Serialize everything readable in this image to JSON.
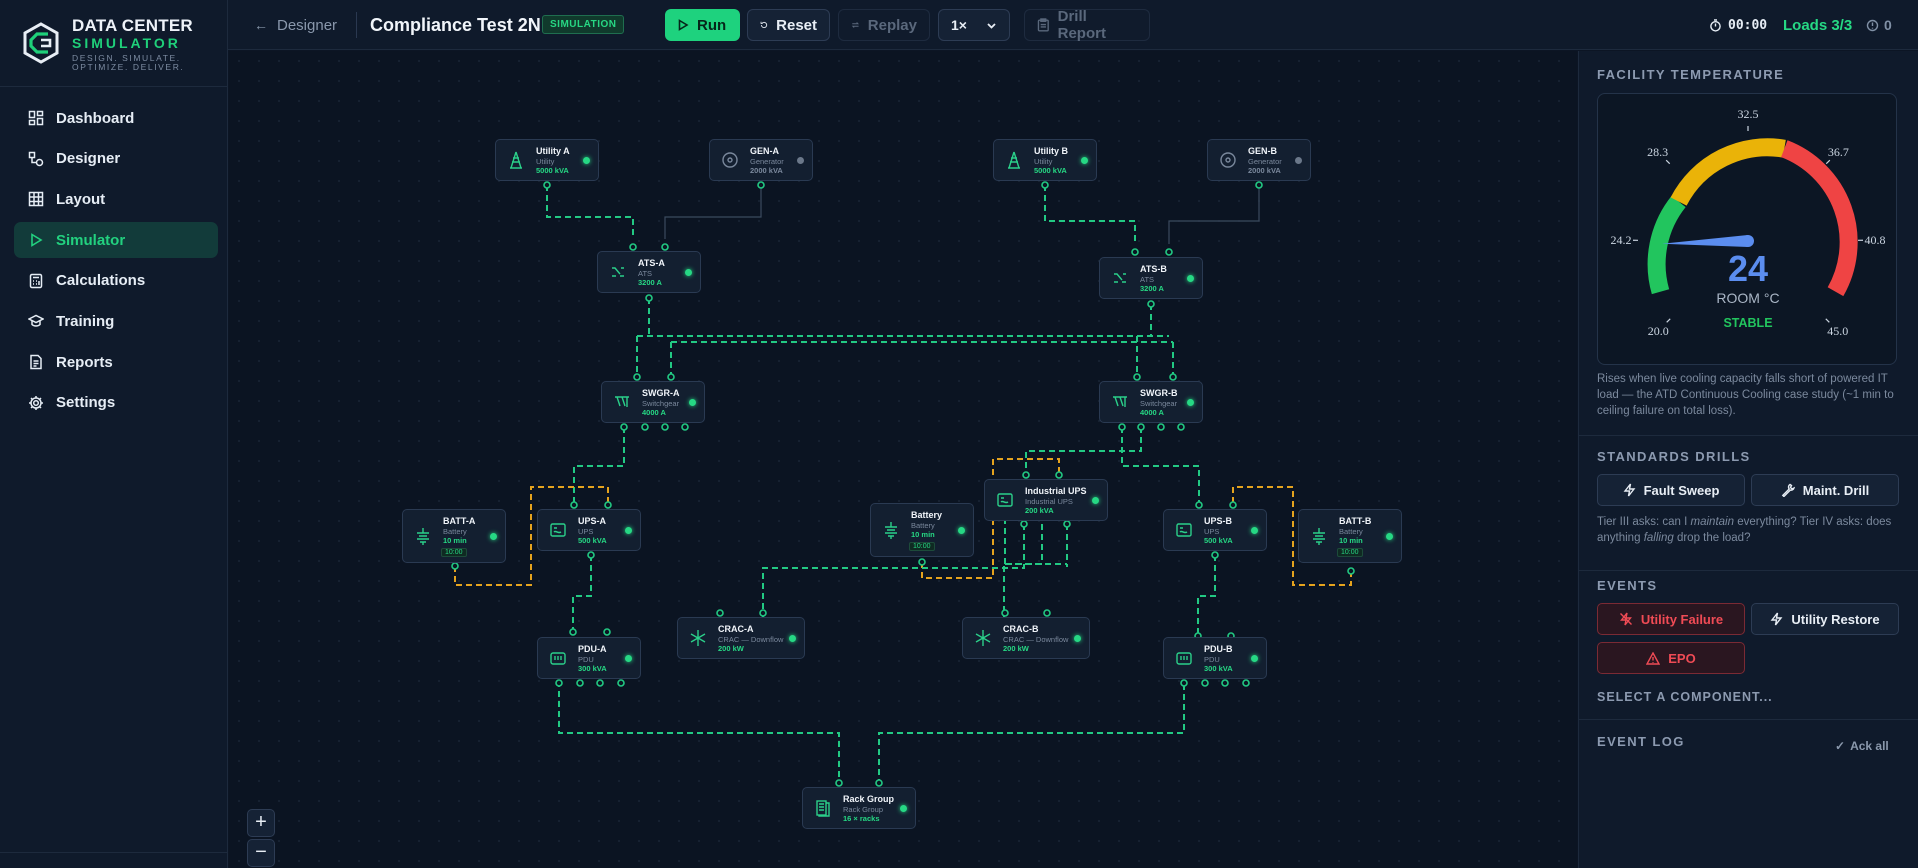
{
  "brand": {
    "line1": "DATA CENTER",
    "line2": "SIMULATOR",
    "tagline": "DESIGN. SIMULATE. OPTIMIZE. DELIVER."
  },
  "nav": [
    {
      "label": "Dashboard",
      "icon": "dashboard-icon"
    },
    {
      "label": "Designer",
      "icon": "designer-icon"
    },
    {
      "label": "Layout",
      "icon": "layout-grid-icon"
    },
    {
      "label": "Simulator",
      "icon": "play-icon",
      "active": true
    },
    {
      "label": "Calculations",
      "icon": "calculator-icon"
    },
    {
      "label": "Training",
      "icon": "graduation-cap-icon"
    },
    {
      "label": "Reports",
      "icon": "document-icon"
    },
    {
      "label": "Settings",
      "icon": "gear-icon"
    }
  ],
  "topbar": {
    "back_label": "Designer",
    "title": "Compliance Test 2N",
    "mode_badge": "SIMULATION",
    "run_label": "Run",
    "reset_label": "Reset",
    "replay_label": "Replay",
    "speed_value": "1×",
    "drill_report_label": "Drill Report",
    "timer": "00:00",
    "loads": "Loads 3/3",
    "alerts": "0"
  },
  "nodes": {
    "utility_a": {
      "name": "Utility A",
      "type": "Utility",
      "cap": "5000 kVA"
    },
    "gen_a": {
      "name": "GEN-A",
      "type": "Generator",
      "cap": "2000 kVA"
    },
    "utility_b": {
      "name": "Utility B",
      "type": "Utility",
      "cap": "5000 kVA"
    },
    "gen_b": {
      "name": "GEN-B",
      "type": "Generator",
      "cap": "2000 kVA"
    },
    "ats_a": {
      "name": "ATS-A",
      "type": "ATS",
      "cap": "3200 A"
    },
    "ats_b": {
      "name": "ATS-B",
      "type": "ATS",
      "cap": "3200 A"
    },
    "swgr_a": {
      "name": "SWGR-A",
      "type": "Switchgear",
      "cap": "4000 A"
    },
    "swgr_b": {
      "name": "SWGR-B",
      "type": "Switchgear",
      "cap": "4000 A"
    },
    "batt_a": {
      "name": "BATT-A",
      "type": "Battery",
      "cap": "10 min",
      "time": "10:00"
    },
    "ups_a": {
      "name": "UPS-A",
      "type": "UPS",
      "cap": "500 kVA"
    },
    "battery": {
      "name": "Battery",
      "type": "Battery",
      "cap": "10 min",
      "time": "10:00"
    },
    "industrial_ups": {
      "name": "Industrial UPS",
      "type": "Industrial UPS",
      "cap": "200 kVA"
    },
    "ups_b": {
      "name": "UPS-B",
      "type": "UPS",
      "cap": "500 kVA"
    },
    "batt_b": {
      "name": "BATT-B",
      "type": "Battery",
      "cap": "10 min",
      "time": "10:00"
    },
    "crac_a": {
      "name": "CRAC-A",
      "type": "CRAC — Downflow",
      "cap": "200 kW"
    },
    "crac_b": {
      "name": "CRAC-B",
      "type": "CRAC — Downflow",
      "cap": "200 kW"
    },
    "pdu_a": {
      "name": "PDU-A",
      "type": "PDU",
      "cap": "300 kVA"
    },
    "pdu_b": {
      "name": "PDU-B",
      "type": "PDU",
      "cap": "300 kVA"
    },
    "rack_group": {
      "name": "Rack Group",
      "type": "Rack Group",
      "cap": "16 × racks"
    }
  },
  "zoom": {
    "in": "+",
    "out": "−"
  },
  "panel": {
    "temp_title": "FACILITY TEMPERATURE",
    "gauge": {
      "value": "24",
      "unit_label": "ROOM °C",
      "status": "STABLE",
      "min": 20.0,
      "max": 45.0,
      "current": 24,
      "ticks": [
        "20.0",
        "24.2",
        "28.3",
        "32.5",
        "36.7",
        "40.8",
        "45.0"
      ],
      "colors": {
        "green": "#22c55e",
        "yellow": "#eab308",
        "red": "#ef4444",
        "needle": "#5b8def"
      }
    },
    "temp_desc": "Rises when live cooling capacity falls short of powered IT load — the ATD Continuous Cooling case study (~1 min to ceiling failure on total loss).",
    "drills_title": "STANDARDS DRILLS",
    "fault_sweep": "Fault Sweep",
    "maint_drill": "Maint. Drill",
    "drills_desc_1": "Tier III asks: can I ",
    "drills_desc_em1": "maintain",
    "drills_desc_2": " everything? Tier IV asks: does anything ",
    "drills_desc_em2": "falling",
    "drills_desc_3": " drop the load?",
    "events_title": "EVENTS",
    "utility_failure": "Utility Failure",
    "utility_restore": "Utility Restore",
    "epo": "EPO",
    "select_component": "SELECT A COMPONENT...",
    "event_log_title": "EVENT LOG",
    "ack_all": "Ack all"
  }
}
